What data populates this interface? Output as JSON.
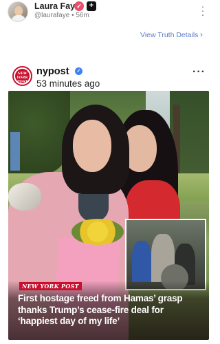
{
  "header": {
    "name": "Laura Faye",
    "handle": "@laurafaye",
    "time": "56m",
    "handle_line": "@laurafaye • 56m"
  },
  "view_truth": {
    "label": "View Truth Details",
    "chevron": "›"
  },
  "card": {
    "source_name": "nypost",
    "time_ago": "53 minutes ago",
    "logo_text": "NEW YORK POST",
    "photo": {
      "tag": "NEW YORK POST",
      "headline": "First hostage freed from Hamas’ grasp thanks Trump’s cease-fire deal for ‘happiest day of my life’"
    }
  },
  "icons": {
    "verified": "verified-icon",
    "plus": "plus-icon",
    "more": "more-options-icon",
    "check": "blue-check-icon",
    "chevron": "chevron-right-icon"
  },
  "colors": {
    "link": "#5b7cc4",
    "brand_red": "#c8102e",
    "verified_pink": "#e8506a",
    "check_blue": "#3b82f6"
  }
}
